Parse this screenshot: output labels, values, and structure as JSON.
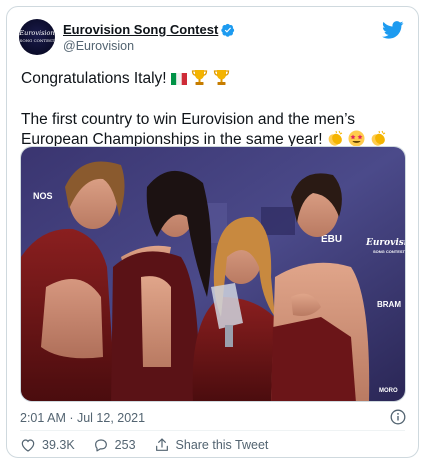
{
  "tweet": {
    "author": {
      "display_name": "Eurovision Song Contest",
      "handle": "@Eurovision",
      "verified": true,
      "avatar_text_line1": "Eurovision",
      "avatar_text_line2": "SONG CONTEST"
    },
    "text_line1": "Congratulations Italy!",
    "text_line1_emojis": [
      "flag-italy",
      "trophy",
      "trophy"
    ],
    "text_paragraph2": "The first country to win Eurovision and the men’s European Championships in the same year!",
    "text_paragraph2_emojis": [
      "clapping-hands",
      "star-struck-face",
      "clapping-hands"
    ],
    "timestamp": "2:01 AM · Jul 12, 2021",
    "likes_count": "39.3K",
    "replies_count": "253",
    "share_label": "Share this Tweet",
    "media": {
      "backdrop_labels": [
        "NOS",
        "EBU",
        "Eurovision",
        "SONG CONTEST",
        "BRAM",
        "MORO"
      ]
    }
  },
  "colors": {
    "accent": "#1d9bf0",
    "text_primary": "#0f1419",
    "text_secondary": "#536471",
    "border": "#cfd9de",
    "like_icon": "#536471"
  },
  "icons": {
    "brand": "twitter-bird-icon",
    "verified": "verified-badge-icon",
    "info": "info-icon",
    "like": "heart-icon",
    "reply": "reply-bubble-icon",
    "share": "share-arrow-icon"
  }
}
